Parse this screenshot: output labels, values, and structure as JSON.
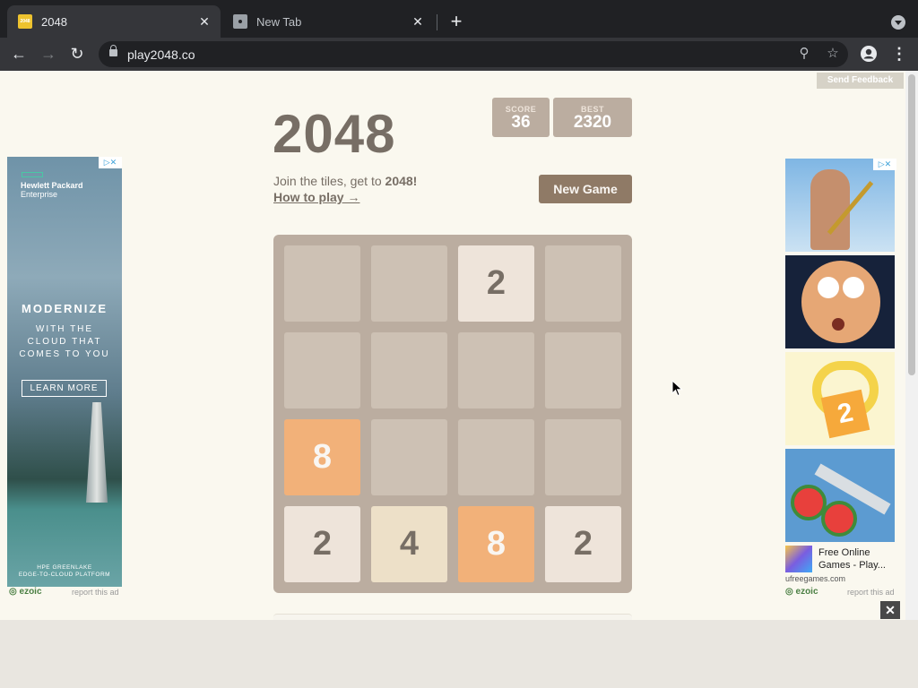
{
  "browser": {
    "tabs": [
      {
        "title": "2048",
        "favicon": "2048-favicon-icon",
        "active": true
      },
      {
        "title": "New Tab",
        "favicon": "chrome-icon",
        "active": false
      }
    ],
    "url": "play2048.co"
  },
  "page": {
    "feedback_label": "Send Feedback",
    "title": "2048",
    "score": {
      "label": "SCORE",
      "value": "36"
    },
    "best": {
      "label": "BEST",
      "value": "2320"
    },
    "intro_text": "Join the tiles, get to ",
    "intro_bold": "2048!",
    "how_to_play": "How to play →",
    "new_game_label": "New Game"
  },
  "board": {
    "tiles": [
      [
        "",
        "",
        "2",
        ""
      ],
      [
        "",
        "",
        "",
        ""
      ],
      [
        "8",
        "",
        "",
        ""
      ],
      [
        "2",
        "4",
        "8",
        "2"
      ]
    ]
  },
  "ads": {
    "left": {
      "brand_line1": "Hewlett Packard",
      "brand_line2": "Enterprise",
      "headline": "MODERNIZE",
      "sub1": "WITH THE",
      "sub2": "CLOUD THAT",
      "sub3": "COMES TO YOU",
      "cta": "LEARN MORE",
      "footer1": "HPE GREENLAKE",
      "footer2": "EDGE-TO-CLOUD PLATFORM",
      "ezoic": "ezoic",
      "report": "report this ad"
    },
    "right": {
      "sponsor_title": "Free Online Games - Play...",
      "sponsor_domain": "ufreegames.com",
      "ezoic": "ezoic",
      "report": "report this ad"
    }
  },
  "colors": {
    "board": "#bbada0",
    "empty_cell": "#cdc1b4",
    "tile_2": "#eee4da",
    "tile_4": "#ede0c8",
    "tile_8": "#f2b179",
    "text": "#776e65",
    "button": "#8f7a66"
  }
}
